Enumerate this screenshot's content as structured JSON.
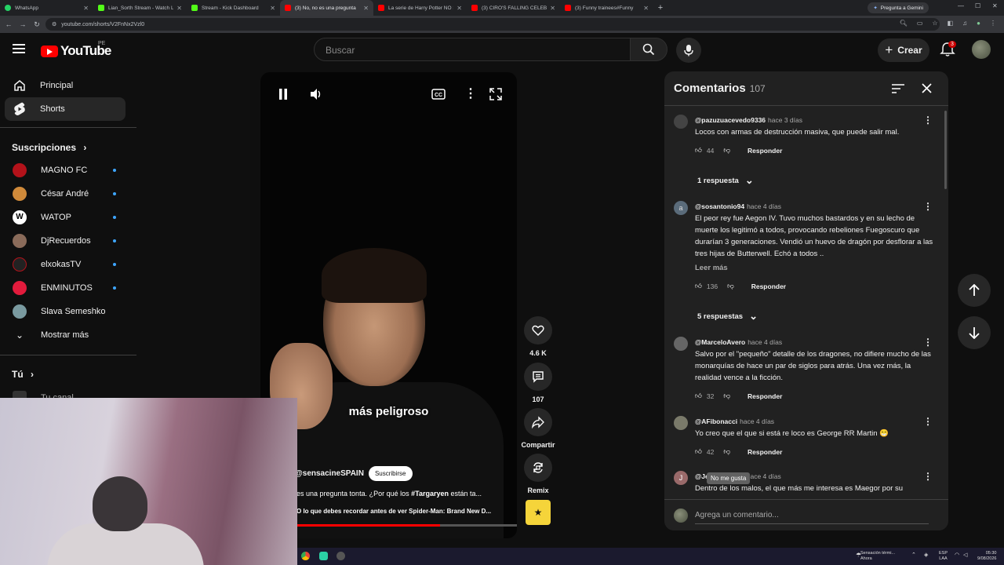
{
  "browser": {
    "tabs": [
      {
        "title": "WhatsApp",
        "color": "#25d366"
      },
      {
        "title": "Lian_Sorth Stream - Watch Live",
        "color": "#53fc18"
      },
      {
        "title": "Stream - Kick Dashboard",
        "color": "#53fc18"
      },
      {
        "title": "(3) No, no es una pregunta",
        "color": "#ff0000"
      },
      {
        "title": "La serie de Harry Potter NO SE",
        "color": "#ff0000"
      },
      {
        "title": "(3) CIRO'S FALLING CELEB",
        "color": "#ff0000"
      },
      {
        "title": "(3) Funny trainees#Funny",
        "color": "#ff0000"
      }
    ],
    "gemini_label": "Pregunta a Gemini",
    "url": "youtube.com/shorts/V2FnNx2Vzl0"
  },
  "header": {
    "logo_text": "YouTube",
    "country": "PE",
    "search_placeholder": "Buscar",
    "create_label": "Crear",
    "notif_count": "3"
  },
  "sidebar": {
    "items": [
      {
        "label": "Principal"
      },
      {
        "label": "Shorts"
      }
    ],
    "subs_title": "Suscripciones",
    "subs": [
      {
        "name": "MAGNO FC",
        "color": "#b3121a"
      },
      {
        "name": "César André",
        "color": "#d08a3a"
      },
      {
        "name": "WATOP",
        "color": "#ffffff"
      },
      {
        "name": "DjRecuerdos",
        "color": "#8a6b5a"
      },
      {
        "name": "elxokasTV",
        "color": "#222222"
      },
      {
        "name": "ENMINUTOS",
        "color": "#e21b3c"
      },
      {
        "name": "Slava Semeshko",
        "color": "#7a9aa0"
      }
    ],
    "show_more": "Mostrar más",
    "you_title": "Tú",
    "your_channel": "Tu canal"
  },
  "video": {
    "caption": "más peligroso",
    "channel": "@sensacineSPAIN",
    "subscribe_label": "Suscribirse",
    "title": "es una pregunta tonta. ¿Por qué los #Targaryen están ta...",
    "link": "O lo que debes recordar antes de ver Spider-Man: Brand New D...",
    "progress": 0.65
  },
  "actions": {
    "likes": "4.6 K",
    "comments": "107",
    "share": "Compartir",
    "remix": "Remix"
  },
  "comments": {
    "title": "Comentarios",
    "count": "107",
    "items": [
      {
        "author": "@pazuzuacevedo9336",
        "time": "hace 3 días",
        "text": "Locos con armas de destrucción masiva, que puede salir mal.",
        "likes": "44",
        "reply": "Responder",
        "avatar": "#444444",
        "replies": "1 respuesta"
      },
      {
        "author": "@sosantonio94",
        "time": "hace 4 días",
        "text": "El peor rey fue Aegon IV. Tuvo muchos bastardos y en su lecho de muerte los legitimó a todos, provocando rebeliones Fuegoscuro que durarían 3 generaciones. Vendió un huevo de dragón por desflorar a las tres hijas de Butterwell. Echó a todos ..",
        "likes": "136",
        "reply": "Responder",
        "avatar": "#5a6b7a",
        "avatar_letter": "a",
        "read_more": "Leer más",
        "replies": "5 respuestas"
      },
      {
        "author": "@MarceloAvero",
        "time": "hace 4 días",
        "text": "Salvo por el \"pequeño\" detalle de los dragones, no difiere mucho de las monarquías de hace un par de siglos para atrás. Una vez más, la realidad vence a la ficción.",
        "likes": "32",
        "reply": "Responder",
        "avatar": "#666666"
      },
      {
        "author": "@AFibonacci",
        "time": "hace 4 días",
        "text": "Yo creo que el que si está re loco es George RR Martin 😁",
        "likes": "42",
        "reply": "Responder",
        "avatar": "#7a7a6a"
      },
      {
        "author": "@Je",
        "time": "hace 4 días",
        "text": "Dentro de los malos, el que más me interesa es Maegor por su",
        "likes": "",
        "reply": "",
        "avatar": "#9a6a6a",
        "avatar_letter": "J"
      }
    ],
    "tooltip": "No me gusta",
    "add_placeholder": "Agrega un comentario..."
  },
  "taskbar": {
    "weather": "Sensación térmi...",
    "weather_sub": "Ahora",
    "lang": "ESP",
    "lang_sub": "LAA",
    "time": "05:30",
    "date": "9/08/2026"
  }
}
